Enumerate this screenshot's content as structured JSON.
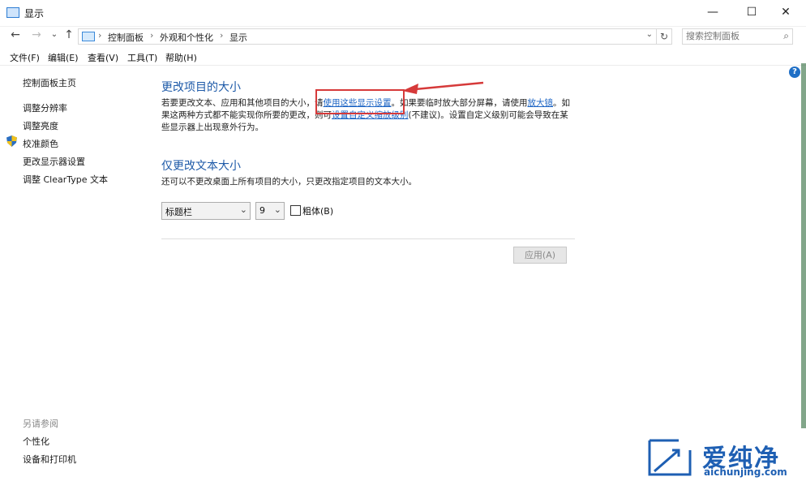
{
  "window": {
    "title": "显示",
    "minimize": "—",
    "maximize": "☐",
    "close": "✕"
  },
  "nav": {
    "back": "←",
    "forward": "→",
    "recent": "⌄",
    "up": "↑"
  },
  "breadcrumb": {
    "items": [
      "控制面板",
      "外观和个性化",
      "显示"
    ],
    "sep": "›"
  },
  "search": {
    "placeholder": "搜索控制面板"
  },
  "menubar": [
    "文件(F)",
    "编辑(E)",
    "查看(V)",
    "工具(T)",
    "帮助(H)"
  ],
  "sidebar": {
    "items": [
      "控制面板主页",
      "调整分辨率",
      "调整亮度",
      "校准颜色",
      "更改显示器设置",
      "调整 ClearType 文本"
    ],
    "see_also_title": "另请参阅",
    "see_also": [
      "个性化",
      "设备和打印机"
    ]
  },
  "section1": {
    "title": "更改项目的大小",
    "p1": "若要更改文本、应用和其他项目的大小，请",
    "link1": "使用这些显示设置",
    "p2": "。如果要临时放大部分屏幕，请使用",
    "link2": "放大镜",
    "p3": "。如果这两种方式都不能实现你所要的更改，则可",
    "link3": "设置自定义缩放级别",
    "p4": "(不建议)。设置自定义级别可能会导致在某些显示器上出现意外行为。"
  },
  "section2": {
    "title": "仅更改文本大小",
    "desc": "还可以不更改桌面上所有项目的大小，只更改指定项目的文本大小。",
    "item_select": "标题栏",
    "size_select": "9",
    "bold_label": "粗体(B)",
    "apply": "应用(A)"
  },
  "watermark": {
    "text": "爱纯净",
    "url": "aichunjing.com"
  },
  "colors": {
    "link": "#1c64c4",
    "heading": "#1e5aa8",
    "annotation": "#d63a3a"
  }
}
